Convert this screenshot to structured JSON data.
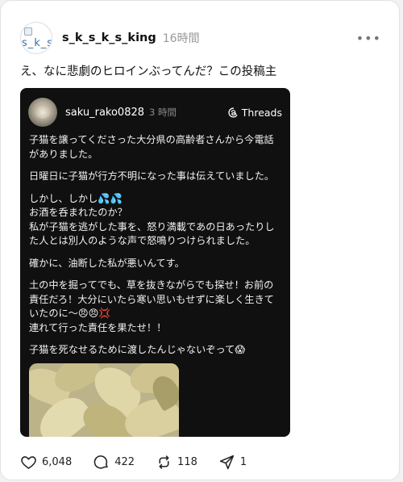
{
  "post": {
    "avatar_alt": "s_k_s",
    "username": "s_k_s_k_s_king",
    "time": "16時間",
    "more": "•••",
    "caption": "え、なに悲劇のヒロインぶってんだ？この投稿主"
  },
  "embed": {
    "username": "saku_rako0828",
    "time": "3 時間",
    "brand": "Threads",
    "paragraphs": [
      "子猫を譲ってくださった大分県の高齢者さんから今電話がありました。",
      "日曜日に子猫が行方不明になった事は伝えていました。",
      "しかし、しかし💦💦\nお酒を呑まれたのか？\n私が子猫を逃がした事を、怒り満載であの日あったりした人とは別人のような声で怒鳴りつけられました。",
      "確かに、油断した私が悪いんてす。",
      "土の中を掘ってでも、草を抜きながらでも探せ！お前の責任だろ！大分にいたら寒い思いもせずに楽しく生きていたのに〜😠😠💢\n連れて行った責任を果たせ！！",
      "子猫を死なせるために渡したんじゃないぞって😱"
    ]
  },
  "actions": {
    "likes": "6,048",
    "replies": "422",
    "reposts": "118",
    "shares": "1"
  },
  "icons": [
    "heart-icon",
    "comment-icon",
    "repost-icon",
    "share-icon",
    "threads-logo-icon",
    "more-icon"
  ]
}
